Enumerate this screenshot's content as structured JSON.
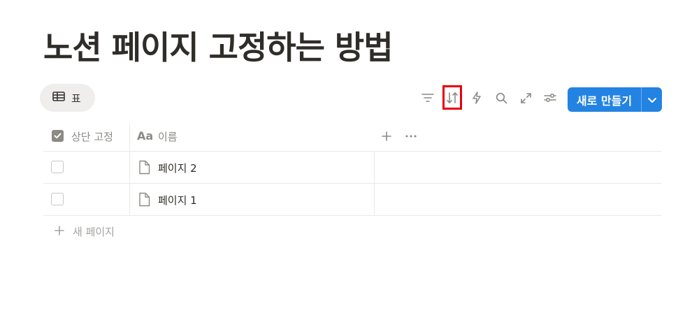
{
  "page": {
    "title": "노션 페이지 고정하는 방법"
  },
  "view_tab": {
    "label": "표",
    "icon": "table-icon"
  },
  "toolbar": {
    "icons": [
      "filter-icon",
      "sort-icon",
      "automation-bolt-icon",
      "search-icon",
      "expand-icon",
      "settings-sliders-icon"
    ],
    "new_button_label": "새로 만들기",
    "new_button_color": "#2383e2",
    "highlight_color": "#e8000b"
  },
  "table": {
    "columns": [
      {
        "label": "상단 고정",
        "icon": "checkbox-checked-icon"
      },
      {
        "label": "이름",
        "icon": "title-aa-icon",
        "icon_text": "Aa"
      }
    ],
    "rows": [
      {
        "pinned": false,
        "name": "페이지 2"
      },
      {
        "pinned": false,
        "name": "페이지 1"
      }
    ],
    "add_row_label": "새 페이지"
  }
}
